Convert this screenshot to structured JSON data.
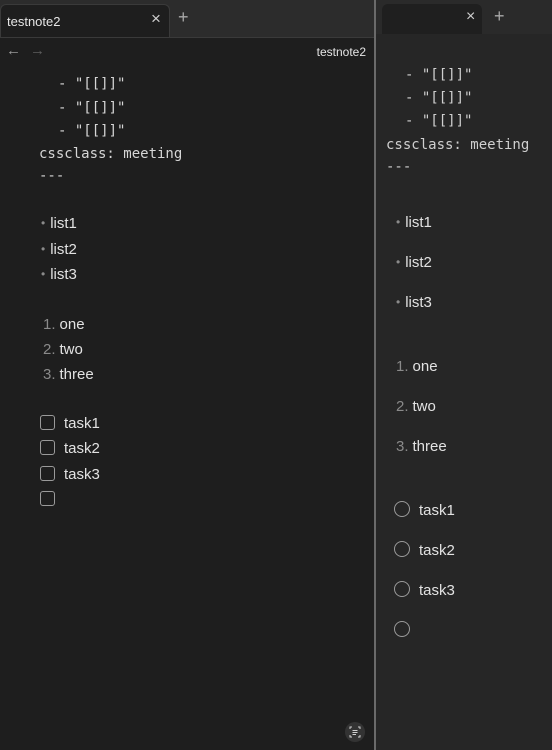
{
  "left": {
    "tab": {
      "title": "testnote2",
      "close": "×"
    },
    "new_tab": "+",
    "nav": {
      "back": "←",
      "forward": "→"
    },
    "note_title": "testnote2",
    "frontmatter": [
      "- \"[[]]\"",
      "- \"[[]]\"",
      "- \"[[]]\"",
      "cssclass: meeting",
      "---"
    ],
    "bullets": [
      "list1",
      "list2",
      "list3"
    ],
    "ordered": [
      {
        "num": "1.",
        "text": "one"
      },
      {
        "num": "2.",
        "text": "two"
      },
      {
        "num": "3.",
        "text": "three"
      }
    ],
    "tasks": [
      "task1",
      "task2",
      "task3",
      ""
    ],
    "icon": "ocr-icon"
  },
  "right": {
    "tab": {
      "close": "×"
    },
    "new_tab": "+",
    "frontmatter": [
      "- \"[[]]\"",
      "- \"[[]]\"",
      "- \"[[]]\"",
      "cssclass: meeting",
      "---"
    ],
    "bullets": [
      "list1",
      "list2",
      "list3"
    ],
    "ordered": [
      {
        "num": "1.",
        "text": "one"
      },
      {
        "num": "2.",
        "text": "two"
      },
      {
        "num": "3.",
        "text": "three"
      }
    ],
    "tasks": [
      "task1",
      "task2",
      "task3",
      ""
    ]
  },
  "colors": {
    "editor_bg": "#1e1e1e",
    "tabbar_bg": "#2c2c2c",
    "text": "#dcddde",
    "muted": "#8a8a8a"
  }
}
